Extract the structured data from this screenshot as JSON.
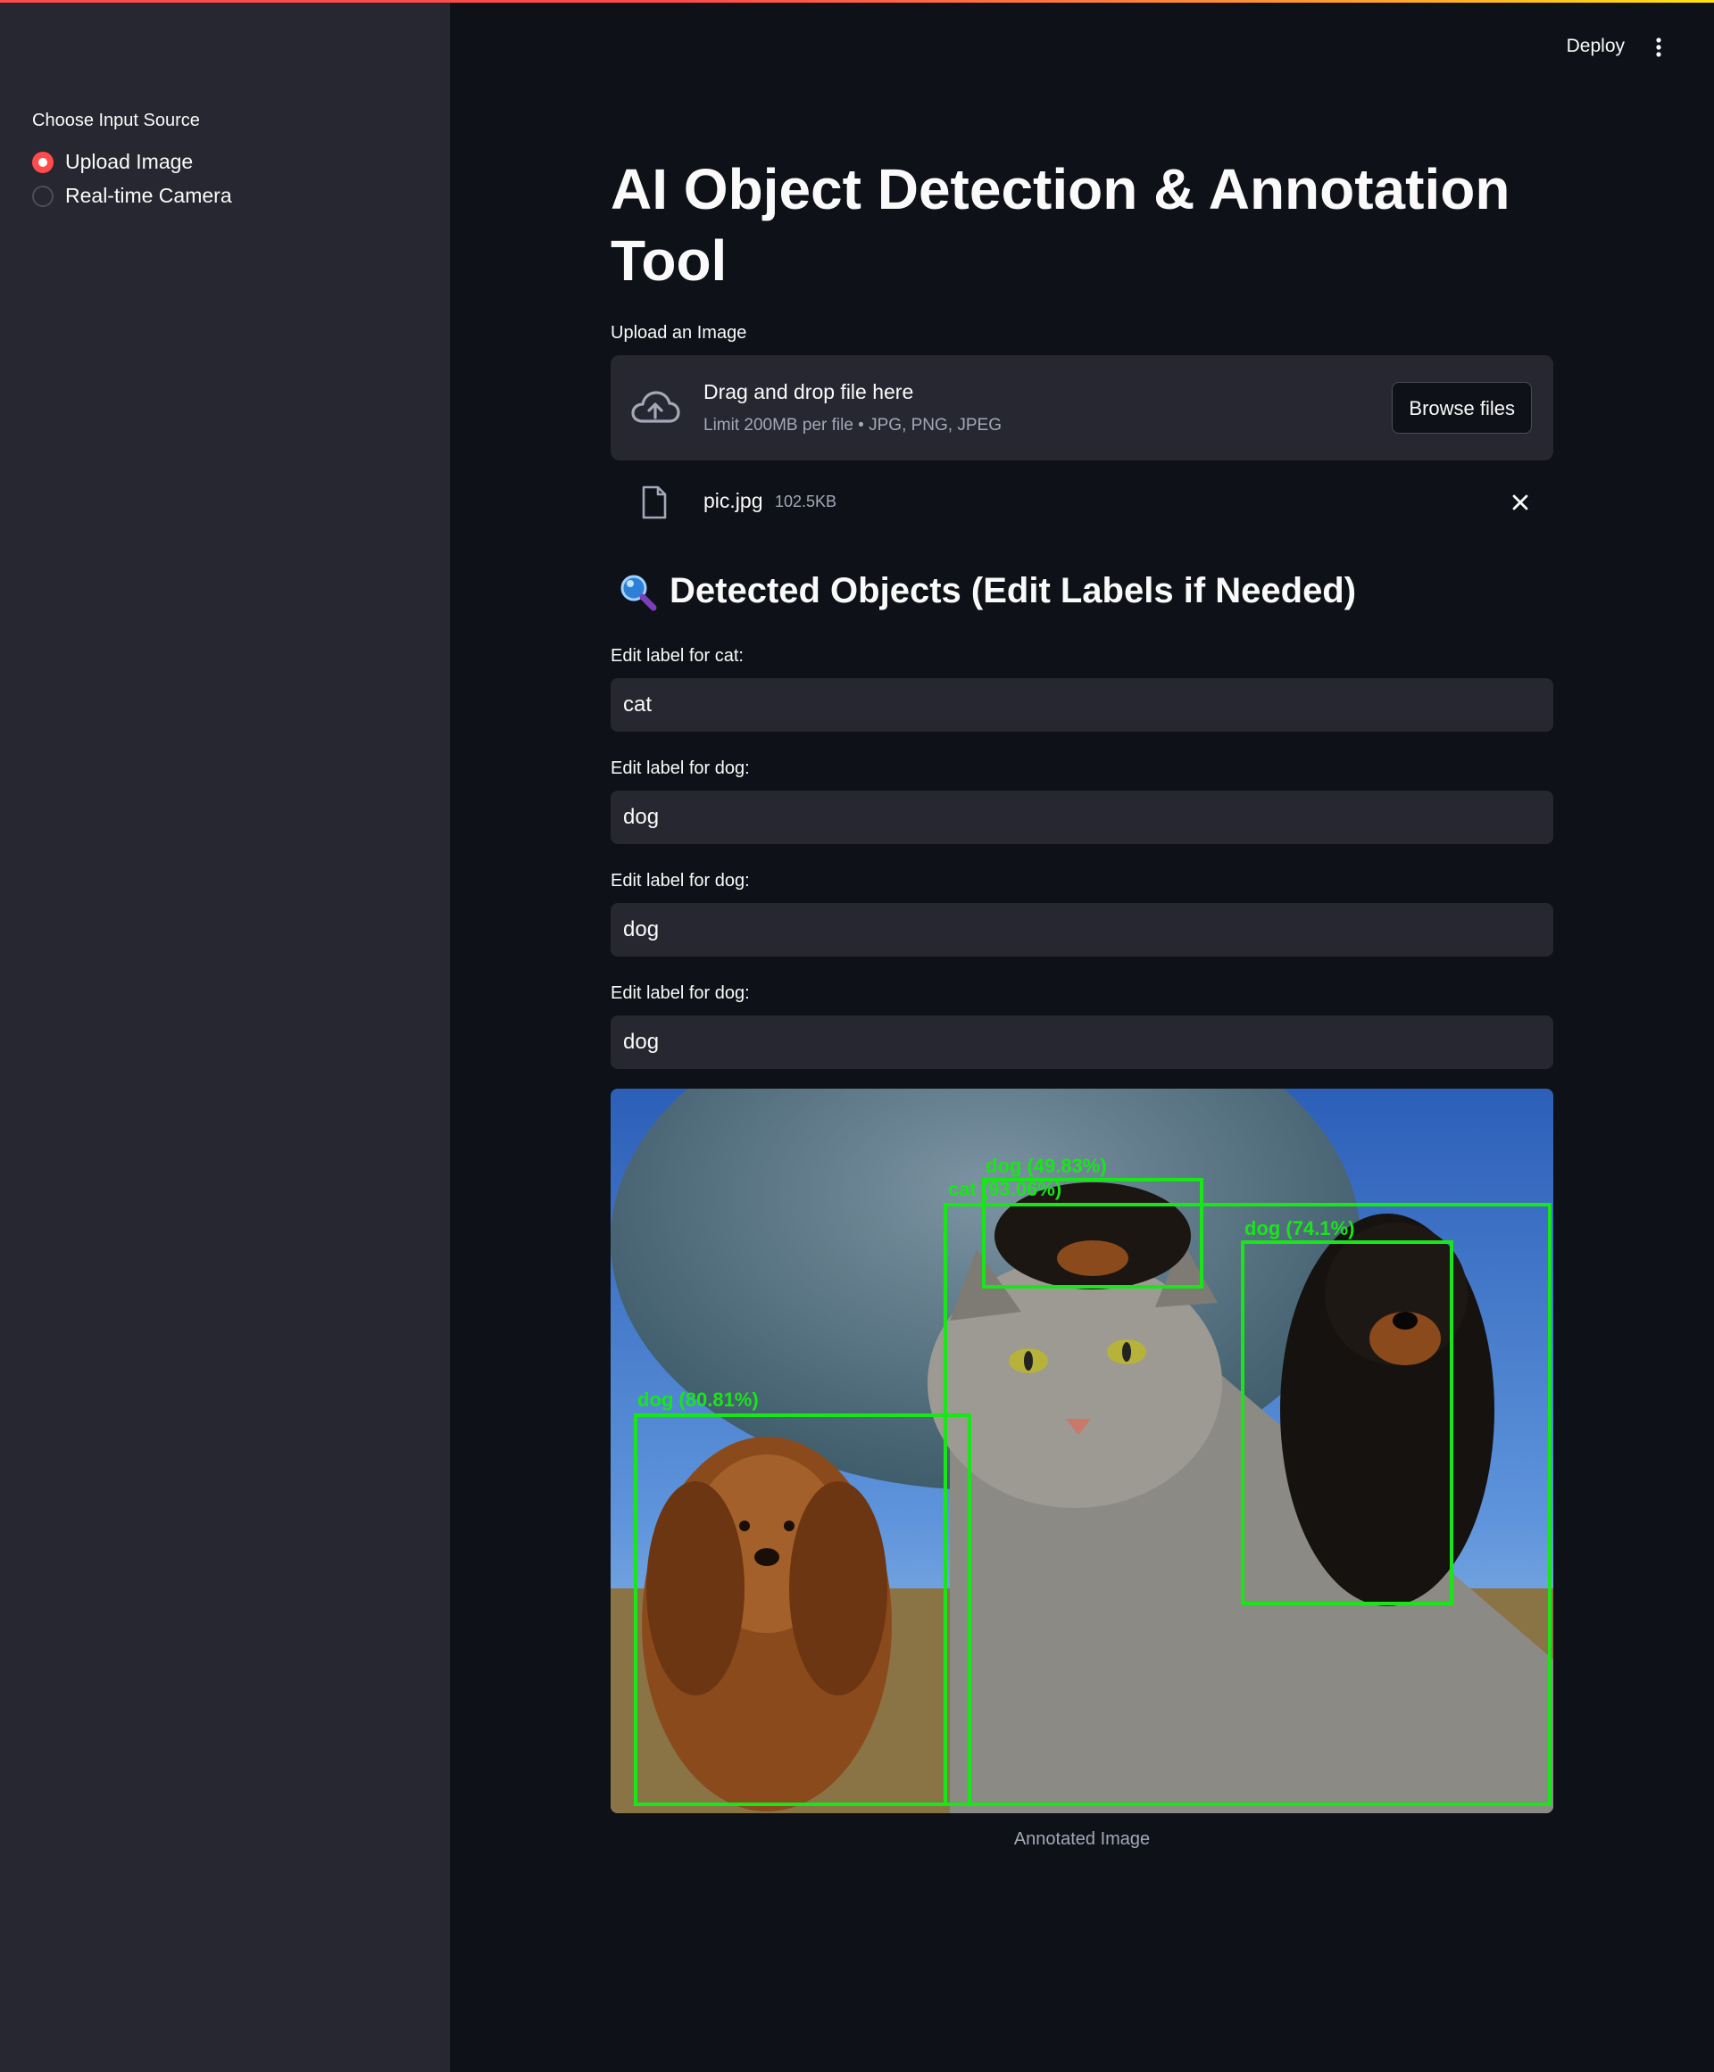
{
  "header": {
    "deploy_label": "Deploy",
    "menu_icon": "more-vertical-icon",
    "accent_colors": [
      "#ff4b4b",
      "#ff9f2e",
      "#ffe312"
    ]
  },
  "sidebar": {
    "title": "Choose Input Source",
    "options": [
      {
        "label": "Upload Image",
        "selected": true
      },
      {
        "label": "Real-time Camera",
        "selected": false
      }
    ],
    "accent_color": "#ff4b4b"
  },
  "main": {
    "title": "AI Object Detection & Annotation Tool",
    "uploader": {
      "label": "Upload an Image",
      "icon": "cloud-upload-icon",
      "drop_text": "Drag and drop file here",
      "limit_text": "Limit 200MB per file • JPG, PNG, JPEG",
      "browse_label": "Browse files"
    },
    "uploaded_file": {
      "icon": "file-icon",
      "name": "pic.jpg",
      "size": "102.5KB",
      "remove_icon": "close-icon"
    },
    "detected": {
      "icon": "magnifying-glass-icon",
      "heading": "Detected Objects (Edit Labels if Needed)",
      "fields": [
        {
          "label": "Edit label for cat:",
          "value": "cat"
        },
        {
          "label": "Edit label for dog:",
          "value": "dog"
        },
        {
          "label": "Edit label for dog:",
          "value": "dog"
        },
        {
          "label": "Edit label for dog:",
          "value": "dog"
        }
      ]
    },
    "annotated_image": {
      "caption": "Annotated Image",
      "box_color": "#19e619",
      "detections": [
        {
          "label": "dog (49.83%)"
        },
        {
          "label": "cat (93.06%)"
        },
        {
          "label": "dog (74.1%)"
        },
        {
          "label": "dog (80.81%)"
        }
      ]
    }
  }
}
